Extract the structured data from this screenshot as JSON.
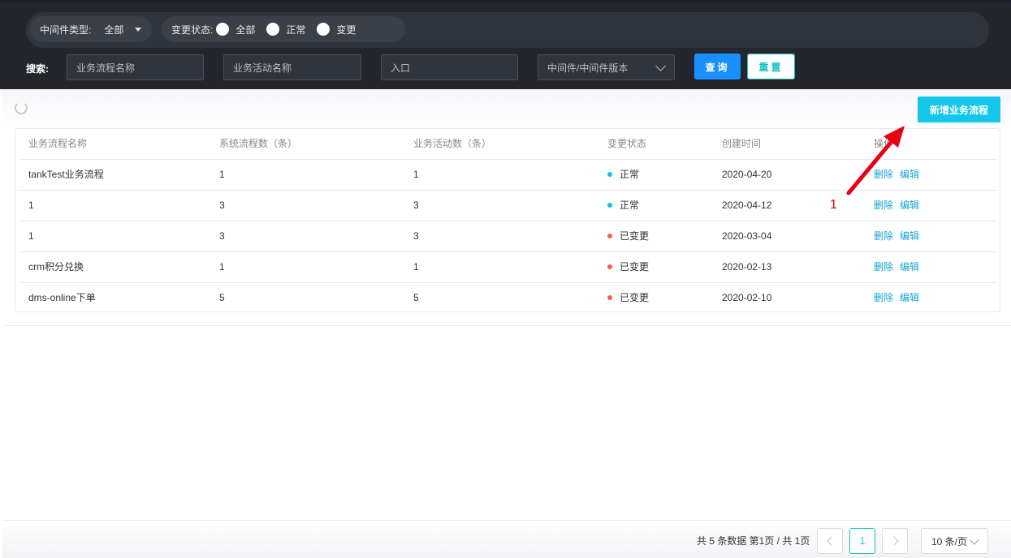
{
  "filters": {
    "middleware_type_label": "中间件类型:",
    "middleware_type_value": "全部",
    "change_status_label": "变更状态:",
    "change_status_options": [
      "全部",
      "正常",
      "变更"
    ]
  },
  "search": {
    "label": "搜索:",
    "process_name_placeholder": "业务流程名称",
    "activity_name_placeholder": "业务活动名称",
    "entry_placeholder": "入口",
    "middleware_version_placeholder": "中间件/中间件版本",
    "query_button": "查询",
    "reset_button": "重置"
  },
  "toolbar": {
    "add_button": "新增业务流程"
  },
  "table": {
    "columns": [
      "业务流程名称",
      "系统流程数（条）",
      "业务活动数（条）",
      "变更状态",
      "创建时间",
      "操作"
    ],
    "rows": [
      {
        "name": "tankTest业务流程",
        "system_flows": "1",
        "activities": "1",
        "status": "正常",
        "status_color": "#13c2e6",
        "created": "2020-04-20",
        "delete": "删除",
        "edit": "编辑"
      },
      {
        "name": "1",
        "system_flows": "3",
        "activities": "3",
        "status": "正常",
        "status_color": "#13c2e6",
        "created": "2020-04-12",
        "delete": "删除",
        "edit": "编辑"
      },
      {
        "name": "1",
        "system_flows": "3",
        "activities": "3",
        "status": "已变更",
        "status_color": "#f0604d",
        "created": "2020-03-04",
        "delete": "删除",
        "edit": "编辑"
      },
      {
        "name": "crm积分兑换",
        "system_flows": "1",
        "activities": "1",
        "status": "已变更",
        "status_color": "#f0604d",
        "created": "2020-02-13",
        "delete": "删除",
        "edit": "编辑"
      },
      {
        "name": "dms-online下单",
        "system_flows": "5",
        "activities": "5",
        "status": "已变更",
        "status_color": "#f0604d",
        "created": "2020-02-10",
        "delete": "删除",
        "edit": "编辑"
      }
    ]
  },
  "annotation": {
    "number": "1"
  },
  "pagination": {
    "summary": "共 5 条数据 第1页 / 共 1页",
    "current_page": "1",
    "page_size": "10 条/页"
  },
  "colors": {
    "accent": "#13c7ea",
    "primary": "#1890ff",
    "topbar": "#23262d",
    "normal_status": "#13c2e6",
    "changed_status": "#f0604d"
  }
}
